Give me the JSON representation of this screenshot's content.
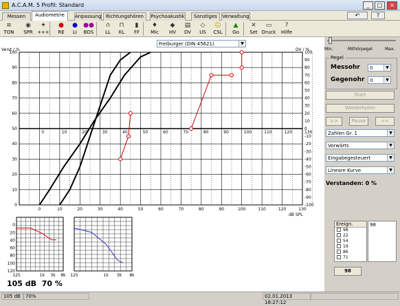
{
  "window": {
    "title": "A.C.A.M. 5  Profil: Standard"
  },
  "tabs": [
    {
      "label": "Messen"
    },
    {
      "label": "Audiometrie"
    },
    {
      "label": "Anpassung"
    },
    {
      "label": "Richtungshören"
    },
    {
      "label": "Psychoakustik"
    },
    {
      "label": "Sonstiges"
    },
    {
      "label": "Verwaltung"
    }
  ],
  "toolbar": [
    {
      "label": "TON",
      "icon": "tone-icon"
    },
    {
      "label": "SPR",
      "icon": "speech-icon"
    },
    {
      "label": "+++",
      "icon": "plus-icon"
    },
    {
      "label": "RE",
      "icon": "right-ear-icon"
    },
    {
      "label": "LI",
      "icon": "left-ear-icon"
    },
    {
      "label": "BDS",
      "icon": "both-ears-icon"
    },
    {
      "label": "LL",
      "icon": "headphones-icon"
    },
    {
      "label": "KL",
      "icon": "bone-icon"
    },
    {
      "label": "FF",
      "icon": "speaker-icon"
    },
    {
      "label": "Mic",
      "icon": "mic-icon"
    },
    {
      "label": "HV",
      "icon": "hv-icon"
    },
    {
      "label": "DV",
      "icon": "dv-icon"
    },
    {
      "label": "US",
      "icon": "us-icon"
    },
    {
      "label": "CSL",
      "icon": "smile-icon"
    },
    {
      "label": "Go",
      "icon": "go-icon"
    },
    {
      "label": "Set",
      "icon": "tools-icon"
    },
    {
      "label": "Druck",
      "icon": "printer-icon"
    },
    {
      "label": "Hilfe",
      "icon": "help-icon"
    }
  ],
  "test_select": "Freiburger (DIN 45621)",
  "slider": {
    "min": "Min.",
    "mid": "Mithörpegel",
    "max": "Max."
  },
  "pegel": {
    "title": "Pegel",
    "messohr_label": "Messohr",
    "messohr_value": "0",
    "gegenohr_label": "Gegenohr",
    "gegenohr_value": "0"
  },
  "buttons": {
    "start": "Start",
    "wiederholen": "Wiederholen",
    "prev": ">>",
    "pause": "Pause",
    "next": "<<"
  },
  "dropdowns": [
    "Zahlen Gr. 1",
    "Vorwärts",
    "Eingabegesteuert",
    "Lineare Kurve"
  ],
  "verstanden": "Verstanden: 0 %",
  "ereign": {
    "header": "Ereign.",
    "items": [
      "98",
      "22",
      "54",
      "19",
      "86",
      "71"
    ],
    "right_value": "98",
    "button": "98"
  },
  "big_readout": {
    "db": "105 dB",
    "pct": "70 %"
  },
  "statusbar": {
    "left": "105 dB",
    "left2": "70%",
    "datetime": "02.01.2013 18:27:12"
  },
  "chart_data": {
    "type": "line",
    "ylabel_left": "Verst / %",
    "ylabel_right": "DV / %",
    "xlabel": "dB SPL",
    "x_ticks": [
      0,
      10,
      20,
      30,
      40,
      50,
      60,
      70,
      80,
      90,
      100,
      110,
      120,
      130
    ],
    "y_ticks": [
      0,
      10,
      20,
      30,
      40,
      50,
      60,
      70,
      80,
      90,
      100
    ],
    "y_right_ticks": [
      100,
      90,
      80,
      70,
      60,
      50,
      40,
      30,
      20,
      10,
      0,
      -10,
      -20,
      -30,
      -40,
      -50,
      -60,
      -70,
      -80,
      -90,
      -100
    ],
    "xlim": [
      -10,
      130
    ],
    "ylim": [
      0,
      100
    ],
    "series": [
      {
        "values": [
          [
            10,
            0
          ],
          [
            15,
            10
          ],
          [
            20,
            25
          ],
          [
            25,
            45
          ],
          [
            30,
            65
          ],
          [
            35,
            85
          ],
          [
            40,
            95
          ],
          [
            45,
            100
          ]
        ]
      },
      {
        "values": [
          [
            0,
            0
          ],
          [
            5,
            10
          ],
          [
            12,
            25
          ],
          [
            20,
            40
          ],
          [
            27,
            55
          ],
          [
            35,
            70
          ],
          [
            42,
            85
          ],
          [
            50,
            97
          ],
          [
            55,
            100
          ]
        ]
      },
      {
        "values": [
          [
            40,
            30
          ],
          [
            44,
            45
          ],
          [
            45,
            60
          ]
        ],
        "color": "#cc0000"
      },
      {
        "values": [
          [
            75,
            50
          ],
          [
            85,
            85
          ],
          [
            95,
            85
          ]
        ],
        "color": "#cc0000"
      },
      {
        "values": [
          [
            100,
            100
          ],
          [
            100,
            90
          ]
        ],
        "color": "#cc0000"
      }
    ]
  },
  "mini_left": {
    "x_labels": [
      "125",
      "1k",
      "3k",
      "8k"
    ],
    "y_labels": [
      "0",
      "20",
      "40",
      "60",
      "80",
      "100",
      "120"
    ]
  },
  "mini_right": {
    "x_labels": [
      "125",
      "1k",
      "3k",
      "8k"
    ]
  }
}
